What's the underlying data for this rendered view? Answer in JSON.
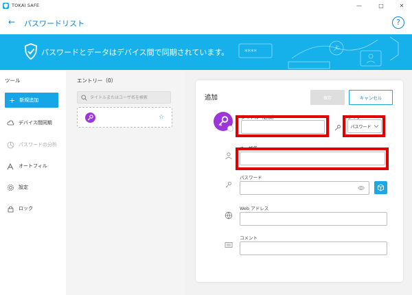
{
  "app": {
    "title": "TOKAI SAFE"
  },
  "window_controls": {
    "minimize": "—",
    "maximize": "□",
    "close": "✕"
  },
  "header": {
    "back_icon": "←",
    "title": "パスワードリスト",
    "help_icon": "?"
  },
  "banner": {
    "text": "パスワードとデータはデバイス間で同期されています。",
    "decoration_text": "****",
    "background": "#16b0ea"
  },
  "sidebar": {
    "heading": "ツール",
    "new_button": "新規追加",
    "items": [
      {
        "label": "デバイス間同期",
        "icon": "cloud-sync-icon",
        "enabled": true
      },
      {
        "label": "パスワードの分析",
        "icon": "analysis-icon",
        "enabled": false
      },
      {
        "label": "オートフィル",
        "icon": "autofill-icon",
        "enabled": true
      },
      {
        "label": "設定",
        "icon": "gear-icon",
        "enabled": true
      },
      {
        "label": "ロック",
        "icon": "lock-icon",
        "enabled": true
      }
    ]
  },
  "entries": {
    "heading": "エントリー（0）",
    "search_placeholder": "タイトルまたはユーザ名を検索",
    "star": "☆"
  },
  "form": {
    "title": "追加",
    "save_label": "保存",
    "cancel_label": "キャンセル",
    "title_field": {
      "label": "タイトル（必須）",
      "value": ""
    },
    "type_field": {
      "label": "タイプ",
      "value": "パスワード"
    },
    "username_field": {
      "label": "ユーザ名",
      "value": ""
    },
    "password_field": {
      "label": "パスワード",
      "value": ""
    },
    "web_field": {
      "label": "Web アドレス",
      "value": ""
    },
    "comment_field": {
      "label": "コメント",
      "value": ""
    }
  },
  "colors": {
    "accent": "#1aa6e0",
    "highlight": "#e00000",
    "avatar": "#9c36d9"
  }
}
